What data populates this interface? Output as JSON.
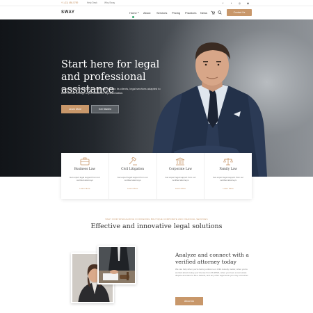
{
  "topbar": {
    "phone": "+1 (11) 486-5789",
    "help": "Help Desk",
    "why": "Why Sway",
    "social_icons": [
      "facebook-icon",
      "twitter-icon",
      "instagram-icon",
      "globe-icon"
    ]
  },
  "header": {
    "logo": "SWAY",
    "nav": [
      "Home",
      "About",
      "Services",
      "Pricing",
      "Practices",
      "News"
    ],
    "cart_icon": "cart-icon",
    "search_icon": "search-icon",
    "contact_label": "Contact Us"
  },
  "hero": {
    "title": "Start here for legal and professional assistance",
    "subtitle": "Sway Legal Services is committed to offer to its clients, legal services adapted to their needs through a personalized representation.",
    "learn_more": "Learn More",
    "get_started": "Get Started"
  },
  "services": [
    {
      "icon": "briefcase-icon",
      "title": "Business Law",
      "desc": "Get expert legal support from our certified attorneys",
      "more": "Learn More"
    },
    {
      "icon": "gavel-icon",
      "title": "Civil Litigation",
      "desc": "Get expert legal support from our certified attorneys",
      "more": "Learn More"
    },
    {
      "icon": "building-icon",
      "title": "Corporate Law",
      "desc": "Get expert legal support from our certified attorneys",
      "more": "Learn More"
    },
    {
      "icon": "scales-icon",
      "title": "Family Law",
      "desc": "Get expert legal support from our certified attorneys",
      "more": "Learn More"
    }
  ],
  "section": {
    "eyebrow": "SWAY FIRM SPECIALIZING IN OFFERING BOUTIQUE CORPORATE AND FINANCIAL SERVICES",
    "title": "Effective and innovative legal solutions",
    "right_title": "Analyze and connect with a verified attorney today",
    "right_body": "We can help when you're facing a divorce or child custody matter, when you're worried about losing your license from DUI/DWI, when you have a real estate dispute and want to file a lawsuit, and any other legal issue you may encounter.",
    "about_label": "About Us"
  },
  "colors": {
    "accent": "#c8976a",
    "nav_active_dot": "#2fa66a"
  }
}
